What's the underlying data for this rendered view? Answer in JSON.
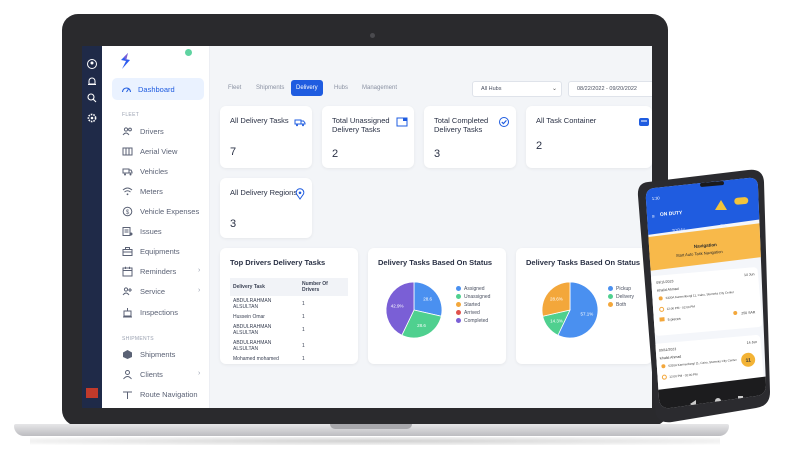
{
  "sidebar": {
    "dashboard": "Dashboard",
    "fleet_section": "FLEET",
    "fleet_items": [
      "Drivers",
      "Aerial View",
      "Vehicles",
      "Meters",
      "Vehicle Expenses",
      "Issues",
      "Equipments",
      "Reminders",
      "Service",
      "Inspections"
    ],
    "shipments_section": "SHIPMENTS",
    "shipment_items": [
      "Shipments",
      "Clients"
    ],
    "cut_item": "Route Navigation"
  },
  "tabs": [
    "Fleet",
    "Shipments",
    "Delivery",
    "Hubs",
    "Management"
  ],
  "active_tab": "Delivery",
  "filters": {
    "hubs": "All Hubs",
    "date_range": "08/22/2022 - 09/20/2022"
  },
  "cards": [
    {
      "title": "All Delivery Tasks",
      "value": "7",
      "icon": "truck-icon"
    },
    {
      "title": "Total Unassigned Delivery Tasks",
      "value": "2",
      "icon": "inbox-icon"
    },
    {
      "title": "Total Completed Delivery Tasks",
      "value": "3",
      "icon": "check-badge-icon"
    },
    {
      "title": "All Task Container",
      "value": "2",
      "icon": "container-icon"
    },
    {
      "title": "All Delivery Regions",
      "value": "3",
      "icon": "map-pin-icon"
    }
  ],
  "top_drivers": {
    "title": "Top Drivers Delivery Tasks",
    "columns": [
      "Delivery Task",
      "Number Of Drivers"
    ],
    "rows": [
      [
        "ABDULRAHMAN ALSULTAN",
        "1"
      ],
      [
        "Hussein Omar",
        "1"
      ],
      [
        "ABDULRAHMAN ALSULTAN",
        "1"
      ],
      [
        "ABDULRAHMAN ALSULTAN",
        "1"
      ],
      [
        "Mohamed mohamed",
        "1"
      ]
    ]
  },
  "chart_data": [
    {
      "type": "pie",
      "title": "Delivery Tasks Based On Status",
      "categories": [
        "Assigned",
        "Unassigned",
        "Started",
        "Arrived",
        "Completed"
      ],
      "values": [
        28.6,
        28.6,
        0,
        0,
        42.9
      ],
      "slice_labels": [
        "28.6",
        "28.6",
        "",
        "",
        "42.9%"
      ],
      "colors": [
        "#4a90f0",
        "#4fd08f",
        "#f3a73b",
        "#e0524d",
        "#7a5fd6"
      ],
      "legend": "right"
    },
    {
      "type": "pie",
      "title": "Delivery Tasks Based On Status",
      "categories": [
        "Pickup",
        "Delivery",
        "Both"
      ],
      "values": [
        57.1,
        14.3,
        28.6
      ],
      "slice_labels": [
        "57.1%",
        "14.3%",
        "28.6%"
      ],
      "colors": [
        "#4a90f0",
        "#4fd08f",
        "#f3a73b"
      ],
      "legend": "right"
    }
  ],
  "phone": {
    "status_left": "1:30",
    "header": "ON DUTY",
    "tabs": [
      "TODAY",
      "ALL"
    ],
    "banner_title": "Navigation",
    "banner_sub": "Start Auto Task Navigation",
    "tasks": [
      {
        "date": "09/11/2023",
        "name": "Khalid Ahmad",
        "address": "6320A Karmenbergl 11, Cairo, Stumeks City Center",
        "time": "12:00 PM - 02:00 PM",
        "pieces": "5 pieces",
        "amount": "250 SAR",
        "tag": "14 Jun"
      },
      {
        "date": "09/11/2023",
        "name": "Khalid Ahmad",
        "address": "6320A Karmenbergl 11, Cairo, Stumeks City Center",
        "time": "12:00 PM - 02:00 PM",
        "pieces": "",
        "amount": "",
        "tag": "14 Jun",
        "badge": "11"
      }
    ]
  }
}
